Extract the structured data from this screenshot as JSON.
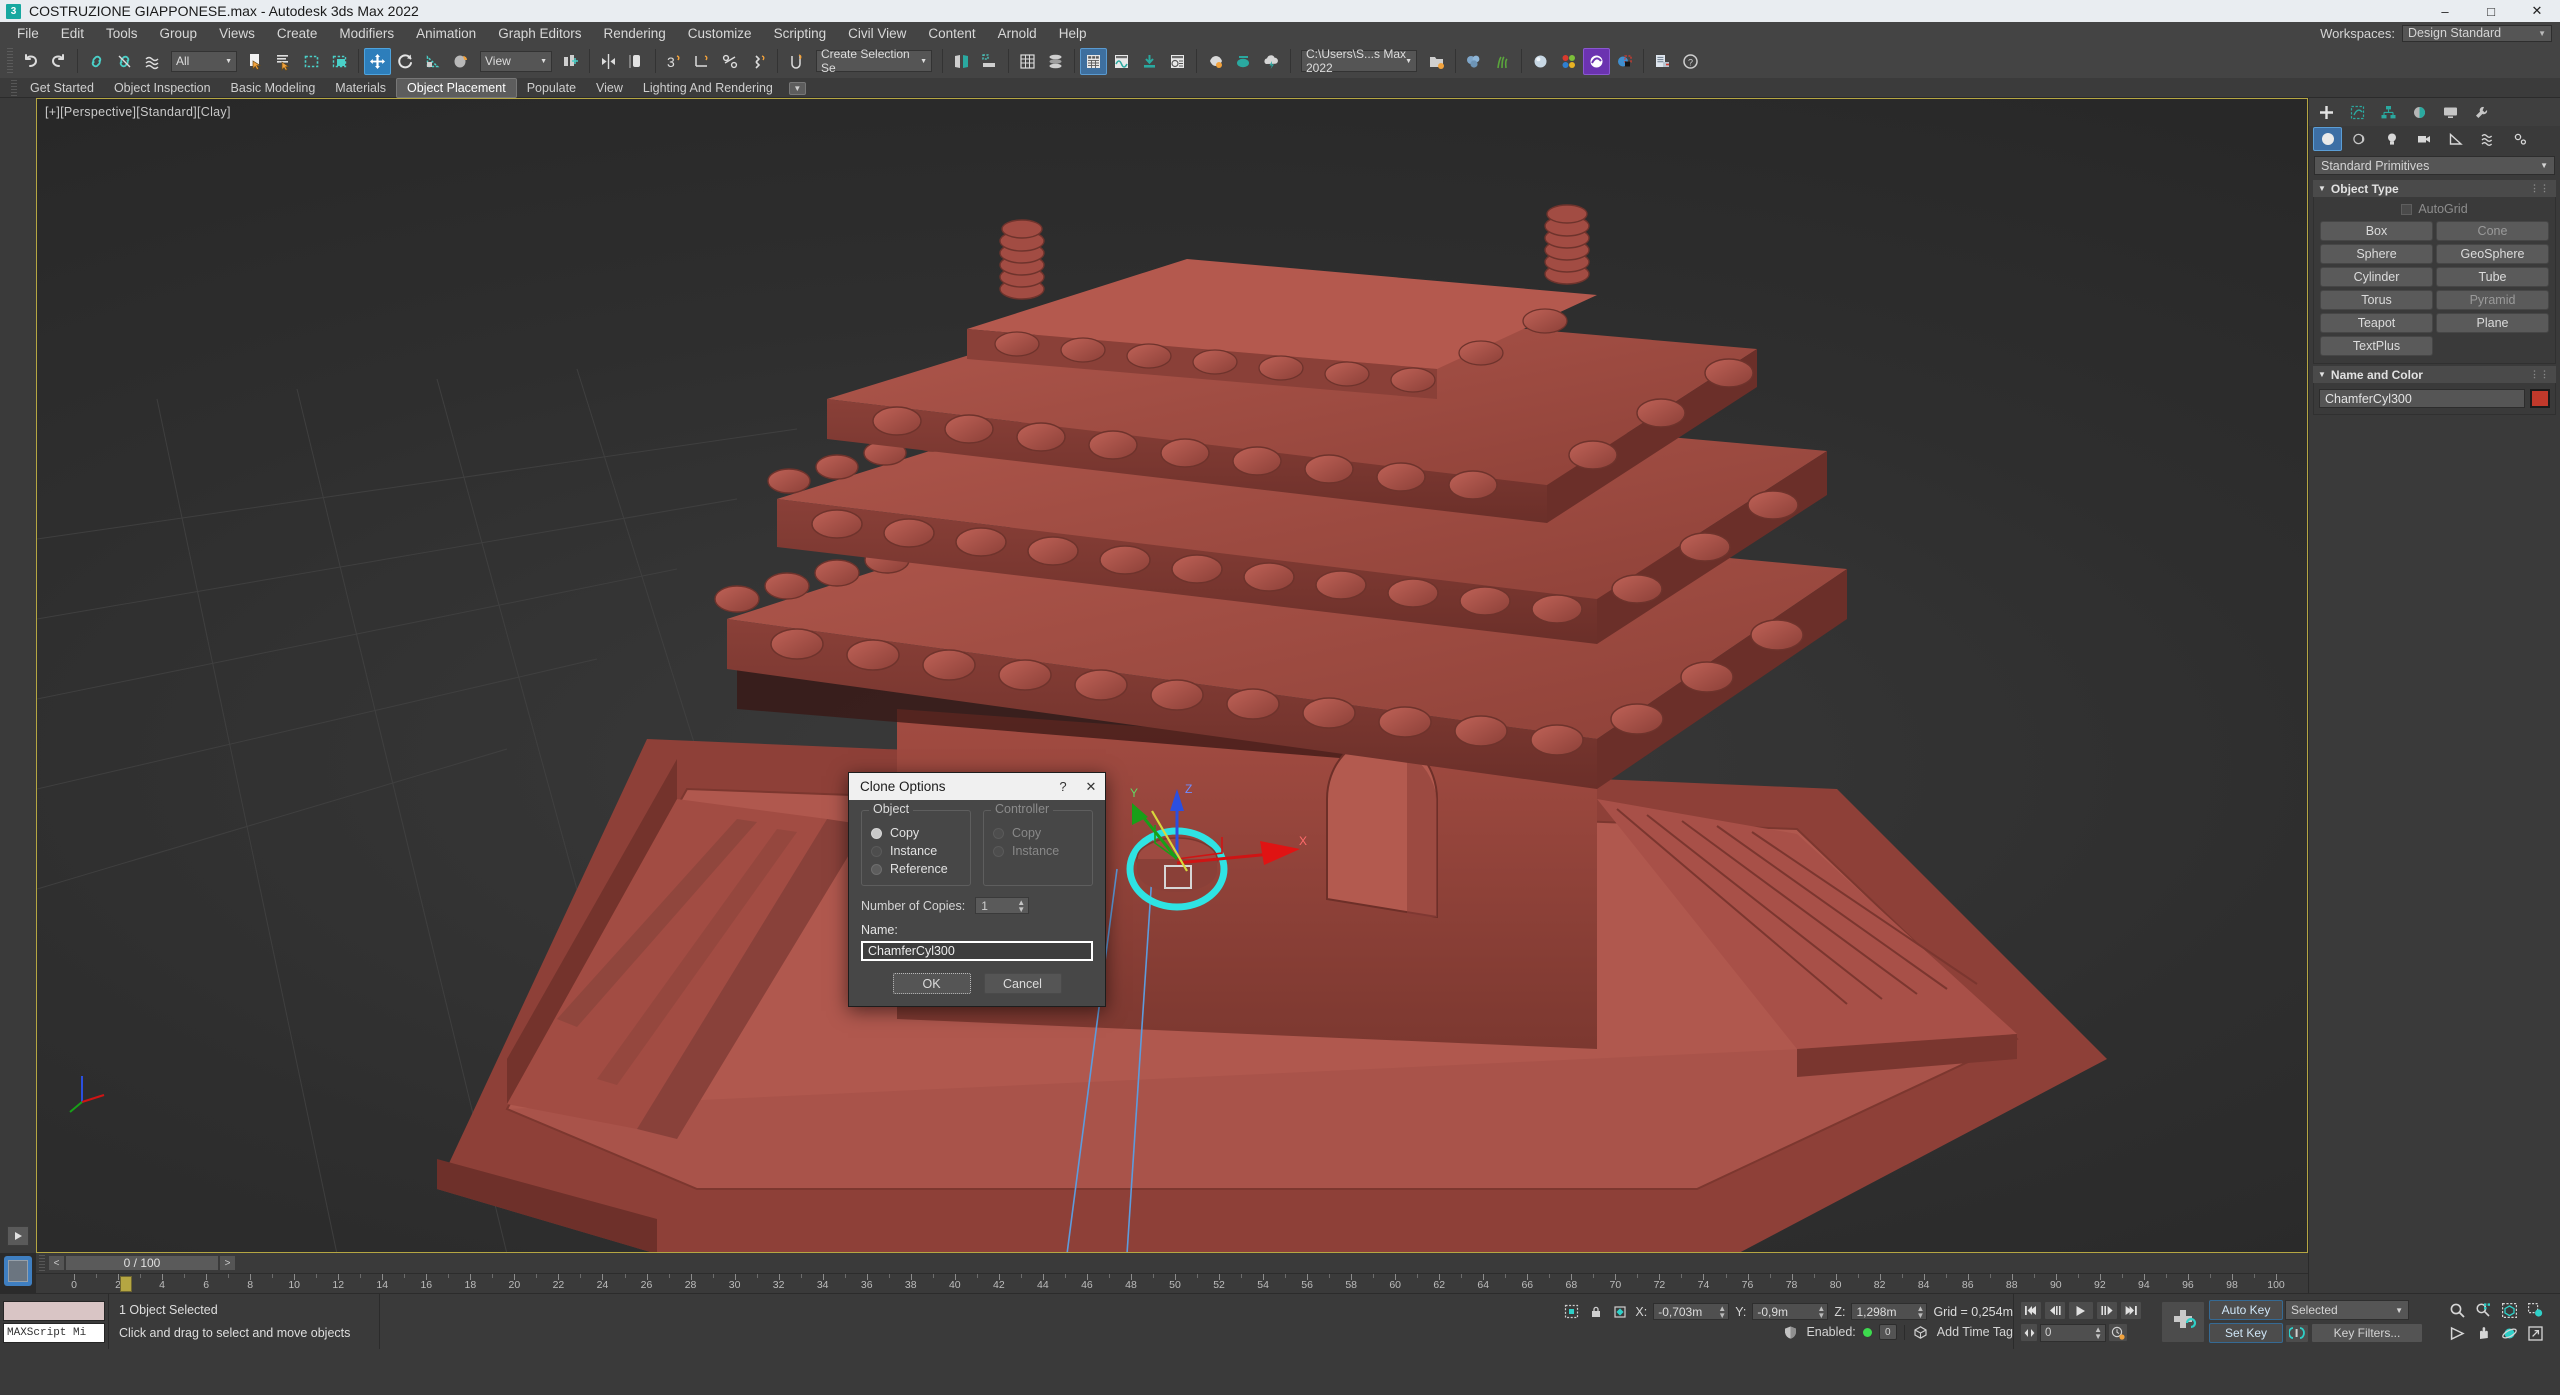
{
  "app": {
    "title": "COSTRUZIONE GIAPPONESE.max - Autodesk 3ds Max 2022",
    "logo_glyph": "3",
    "window_buttons": [
      {
        "name": "minimize-button",
        "glyph": "–"
      },
      {
        "name": "maximize-button",
        "glyph": "☐"
      },
      {
        "name": "close-button",
        "glyph": "✕"
      }
    ]
  },
  "menubar": {
    "items": [
      "File",
      "Edit",
      "Tools",
      "Group",
      "Views",
      "Create",
      "Modifiers",
      "Animation",
      "Graph Editors",
      "Rendering",
      "Customize",
      "Scripting",
      "Civil View",
      "Content",
      "Arnold",
      "Help"
    ],
    "workspaces_label": "Workspaces:",
    "workspace_value": "Design Standard"
  },
  "toolbar": {
    "selection_filter": "All",
    "reference_coord": "View",
    "named_selection": "Create Selection Se",
    "project_path": "C:\\Users\\S...s Max 2022"
  },
  "ribbon": {
    "tabs": [
      "Get Started",
      "Object Inspection",
      "Basic Modeling",
      "Materials",
      "Object Placement",
      "Populate",
      "View",
      "Lighting And Rendering"
    ],
    "active_tab": "Object Placement"
  },
  "viewport": {
    "label": "[+][Perspective][Standard][Clay]",
    "gizmo_axes": [
      "X",
      "Y",
      "Z"
    ]
  },
  "command_panel": {
    "tabs": [
      "create-tab",
      "modify-tab",
      "hierarchy-tab",
      "motion-tab",
      "display-tab",
      "utilities-tab"
    ],
    "subtabs": [
      "geometry-icon",
      "shapes-icon",
      "lights-icon",
      "cameras-icon",
      "helpers-icon",
      "spacewarps-icon",
      "systems-icon"
    ],
    "category": "Standard Primitives",
    "object_type": {
      "title": "Object Type",
      "autogrid_label": "AutoGrid",
      "buttons": [
        "Box",
        "Cone",
        "Sphere",
        "GeoSphere",
        "Cylinder",
        "Tube",
        "Torus",
        "Pyramid",
        "Teapot",
        "Plane",
        "TextPlus"
      ]
    },
    "name_and_color": {
      "title": "Name and Color",
      "name": "ChamferCyl300",
      "color": "#c0392b"
    }
  },
  "clone_dialog": {
    "title": "Clone Options",
    "help_glyph": "?",
    "close_glyph": "✕",
    "object_group": {
      "label": "Object",
      "options": [
        "Copy",
        "Instance",
        "Reference"
      ],
      "selected": "Copy"
    },
    "controller_group": {
      "label": "Controller",
      "options": [
        "Copy",
        "Instance"
      ],
      "selected": "Copy",
      "disabled": true
    },
    "copies_label": "Number of Copies:",
    "copies_value": "1",
    "name_label": "Name:",
    "name_value": "ChamferCyl300",
    "ok_label": "OK",
    "cancel_label": "Cancel"
  },
  "timeline": {
    "slider_value": "0 / 100",
    "prev_glyph": "<",
    "next_glyph": ">",
    "tick_labels": [
      0,
      2,
      4,
      6,
      8,
      10,
      12,
      14,
      16,
      18,
      20,
      22,
      24,
      26,
      28,
      30,
      32,
      34,
      36,
      38,
      40,
      42,
      44,
      46,
      48,
      50,
      52,
      54,
      56,
      58,
      60,
      62,
      64,
      66,
      68,
      70,
      72,
      74,
      76,
      78,
      80,
      82,
      84,
      86,
      88,
      90,
      92,
      94,
      96,
      98,
      100
    ]
  },
  "statusbar": {
    "maxscript_label": "MAXScript Mi",
    "selection_status": "1 Object Selected",
    "prompt": "Click and drag to select and move objects",
    "coords": [
      {
        "axis": "X:",
        "value": "-0,703m"
      },
      {
        "axis": "Y:",
        "value": "-0,9m"
      },
      {
        "axis": "Z:",
        "value": "1,298m"
      }
    ],
    "grid_text": "Grid = 0,254m",
    "enabled_label": "Enabled:",
    "enabled_count": "0",
    "add_time_tag": "Add Time Tag",
    "auto_key": "Auto Key",
    "set_key": "Set Key",
    "key_mode": "Selected",
    "key_filters": "Key Filters...",
    "current_frame": "0"
  }
}
